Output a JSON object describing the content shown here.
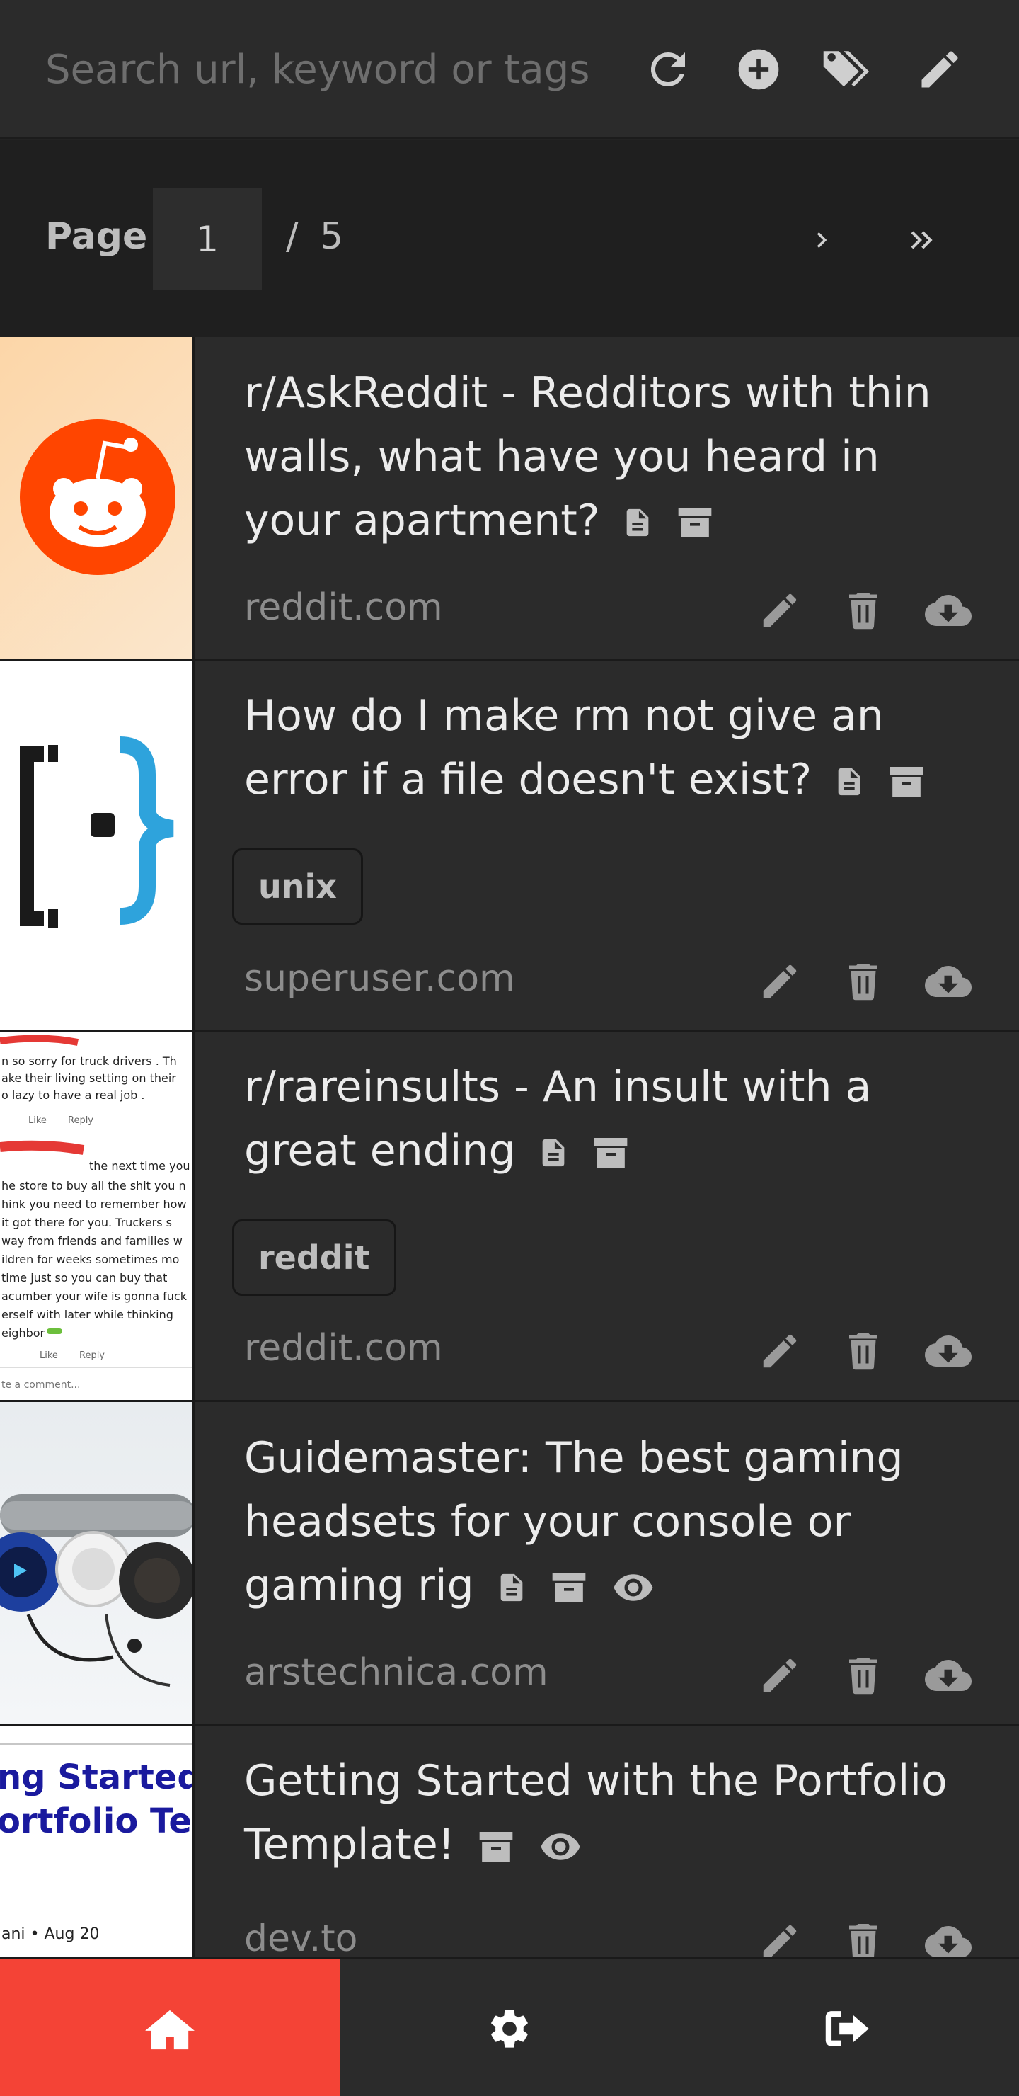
{
  "search": {
    "placeholder": "Search url, keyword or tags",
    "value": ""
  },
  "toolbar": {
    "icons": [
      "refresh-icon",
      "add-circle-icon",
      "tags-icon",
      "edit-icon"
    ]
  },
  "pagination": {
    "label": "Page",
    "current": "1",
    "separator": "/",
    "total": "5"
  },
  "bookmarks": [
    {
      "title": "r/AskReddit - Redditors with thin walls, what have you heard in your apartment?",
      "domain": "reddit.com",
      "tags": [],
      "icons": [
        "document-icon",
        "archive-icon"
      ],
      "thumbnail": "reddit-logo"
    },
    {
      "title": "How do I make rm not give an error if a file doesn't exist?",
      "domain": "superuser.com",
      "tags": [
        "unix"
      ],
      "icons": [
        "document-icon",
        "archive-icon"
      ],
      "thumbnail": "superuser-logo"
    },
    {
      "title": "r/rareinsults - An insult with a great ending",
      "domain": "reddit.com",
      "tags": [
        "reddit"
      ],
      "icons": [
        "document-icon",
        "archive-icon"
      ],
      "thumbnail": "comment-screenshot"
    },
    {
      "title": "Guidemaster: The best gaming headsets for your console or gaming rig",
      "domain": "arstechnica.com",
      "tags": [],
      "icons": [
        "document-icon",
        "archive-icon",
        "eye-icon"
      ],
      "thumbnail": "headsets-photo"
    },
    {
      "title": "Getting Started with the Portfolio Template!",
      "domain": "dev.to",
      "tags": [],
      "icons": [
        "archive-icon",
        "eye-icon"
      ],
      "thumbnail": "article-preview"
    }
  ],
  "thumb_text": {
    "insult_lines": [
      "n so sorry for truck drivers . Th",
      "ake their living setting on their",
      "o lazy to have a real job .",
      "the next time you",
      "he store to buy all the shit you n",
      "hink you need to remember how",
      "it got there for you. Truckers s",
      "way from friends and families w",
      "ildren for weeks sometimes mo",
      "time just so you can buy that",
      "acumber your wife is gonna fuck",
      "erself with later while thinking",
      "eighbor"
    ],
    "insult_like": "Like",
    "insult_reply": "Reply",
    "insult_comment": "te a comment...",
    "devto_line1": "ng Started w",
    "devto_line2": "ortfolio Tem",
    "devto_date": "ani • Aug 20"
  },
  "card_actions": [
    "edit-icon",
    "delete-icon",
    "download-icon"
  ],
  "bottom_nav": [
    {
      "name": "home",
      "icon": "home-icon",
      "active": true
    },
    {
      "name": "settings",
      "icon": "gear-icon",
      "active": false
    },
    {
      "name": "logout",
      "icon": "logout-icon",
      "active": false
    }
  ],
  "colors": {
    "accent": "#f44336",
    "background": "#232323",
    "card": "#2b2b2b",
    "text": "#ececec",
    "muted": "#8d8d8d"
  }
}
